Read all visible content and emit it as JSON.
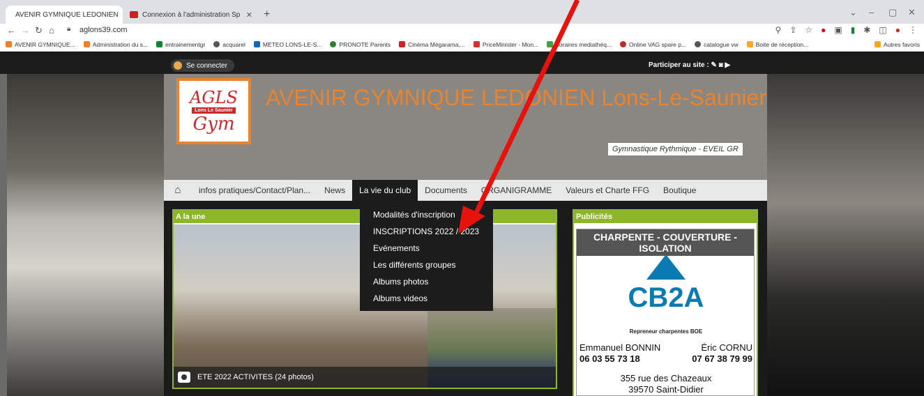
{
  "browser": {
    "tabs": [
      {
        "title": "AVENIR GYMNIQUE LEDONIEN",
        "active": true
      },
      {
        "title": "Connexion à l'administration Sp",
        "active": false
      }
    ],
    "url": "aglons39.com",
    "bookmarks": [
      "AVENIR GYMNIQUE...",
      "Administration du s...",
      "entrainementgr",
      "acquarel",
      "METEO LONS-LE-S...",
      "PRONOTE Parents",
      "Cinéma Mégarama,...",
      "PriceMinister - Mon...",
      "horaires mediathéq...",
      "Online VAG spare p...",
      "catalogue vw",
      "Boite de réception...",
      "Autres favoris"
    ]
  },
  "site": {
    "connect_label": "Se connecter",
    "participer_label": "Participer au site :",
    "title": "AVENIR GYMNIQUE LEDONIEN Lons-Le-Saunier",
    "slogan": "Gymnastique Rythmique - EVEIL GR",
    "logo": {
      "line1": "AGLS",
      "line2": "Lons Le Saunier",
      "line3": "Gym"
    }
  },
  "nav": {
    "items": [
      "infos pratiques/Contact/Plan...",
      "News",
      "La vie du club",
      "Documents",
      "ORGANIGRAMME",
      "Valeurs et Charte FFG",
      "Boutique"
    ],
    "active": "La vie du club",
    "dropdown": [
      "Modalités d'inscription",
      "INSCRIPTIONS 2022 / 2023",
      "Evénements",
      "Les différents groupes",
      "Albums photos",
      "Albums videos"
    ]
  },
  "une": {
    "heading": "A la une",
    "caption": "ETE 2022 ACTIVITES (24 photos)"
  },
  "pub": {
    "heading": "Publicités",
    "banner": "CHARPENTE - COUVERTURE - ISOLATION",
    "brand": "CB2A",
    "repreneur": "Repreneur charpentes BOE",
    "name1": "Emmanuel BONNIN",
    "name2": "Éric CORNU",
    "phone1": "06 03 55 73 18",
    "phone2": "07 67 38 79 99",
    "address1": "355 rue des Chazeaux",
    "address2": "39570 Saint-Didier"
  },
  "colors": {
    "accent": "#e8832f",
    "green": "#8db628",
    "arrow": "#e8120c"
  }
}
